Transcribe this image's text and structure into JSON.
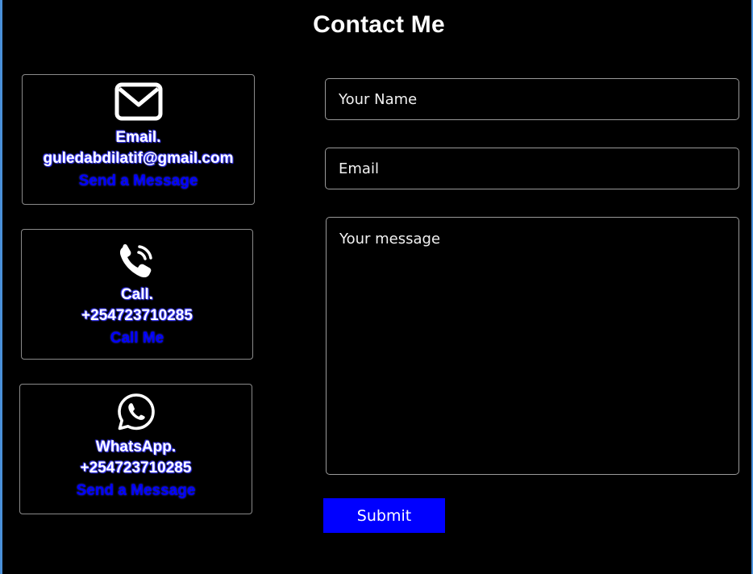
{
  "page": {
    "title": "Contact Me"
  },
  "contacts": [
    {
      "icon": "envelope-icon",
      "label": "Email.",
      "value": "guledabdilatif@gmail.com",
      "action": "Send a Message"
    },
    {
      "icon": "phone-call-icon",
      "label": "Call.",
      "value": "+254723710285",
      "action": "Call Me"
    },
    {
      "icon": "whatsapp-icon",
      "label": "WhatsApp.",
      "value": "+254723710285",
      "action": "Send a Message"
    }
  ],
  "form": {
    "name_placeholder": "Your Name",
    "name_value": "",
    "email_placeholder": "Email",
    "email_value": "",
    "message_placeholder": "Your message",
    "message_value": "",
    "submit_label": "Submit"
  },
  "colors": {
    "background": "#000000",
    "accent": "#0000ff",
    "text": "#ffffff",
    "border": "#8a8a8a",
    "frame_edge": "#4a90d9"
  }
}
